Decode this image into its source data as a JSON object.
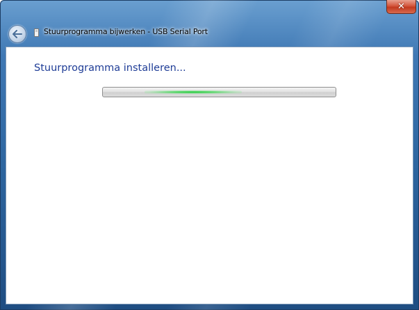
{
  "window": {
    "title": "Stuurprogramma bijwerken - USB Serial Port",
    "close_label": "✕"
  },
  "content": {
    "heading": "Stuurprogramma installeren...",
    "progress": {
      "mode": "indeterminate",
      "glow_color": "#23c83c"
    }
  },
  "colors": {
    "frame": "#2d659f",
    "heading_text": "#1e3c96",
    "close_button": "#c23a1f"
  },
  "icons": {
    "back": "back-arrow-icon",
    "title": "driver-icon",
    "close": "close-icon"
  }
}
